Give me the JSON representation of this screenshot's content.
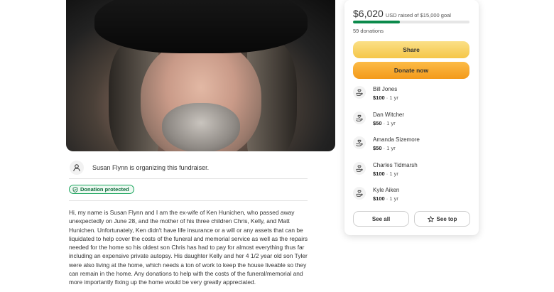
{
  "hero": {
    "image": "organizer-photo-man-in-cowboy-hat"
  },
  "organizer": {
    "text": "Susan Flynn is organizing this fundraiser."
  },
  "badge": {
    "label": "Donation protected"
  },
  "story": {
    "text": "Hi, my name is Susan Flynn and I am the ex-wife of Ken Hunichen, who passed away unexpectedly on June 28, and the mother of his three children Chris, Kelly, and Matt Hunichen. Unfortunately, Ken didn't have life insurance or a will or any assets that can be liquidated to help cover the costs of the funeral and memorial service as well as the repairs needed for the home so his oldest son Chris has had to pay for almost everything thus far including an expensive private autopsy. His daughter Kelly and her 4 1/2 year old son Tyler were also living at the home, which needs a ton of work to keep the house liveable so they can remain in the home. Any donations to help with the costs of the funeral/memorial and more importantly fixing up the home would be very greatly appreciated."
  },
  "sidebar": {
    "raised": "$6,020",
    "goal_text": "USD raised of $15,000 goal",
    "progress_fraction": 0.4013,
    "donation_count": "59 donations",
    "share_label": "Share",
    "donate_label": "Donate now",
    "donors": [
      {
        "name": "Bill Jones",
        "amount": "$100",
        "time": "1 yr"
      },
      {
        "name": "Dan Witcher",
        "amount": "$50",
        "time": "1 yr"
      },
      {
        "name": "Amanda Sizemore",
        "amount": "$50",
        "time": "1 yr"
      },
      {
        "name": "Charles Tidmarsh",
        "amount": "$100",
        "time": "1 yr"
      },
      {
        "name": "Kyle Aiken",
        "amount": "$100",
        "time": "1 yr"
      }
    ],
    "see_all_label": "See all",
    "see_top_label": "See top"
  },
  "colors": {
    "progress": "#0b8a4b",
    "share": "#f5c648",
    "donate": "#f39a1b",
    "badge": "#17a45b"
  }
}
